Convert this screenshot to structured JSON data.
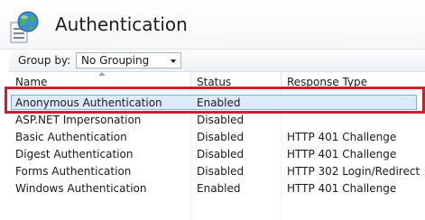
{
  "header": {
    "title": "Authentication",
    "icon": "globe-document-icon"
  },
  "toolbar": {
    "group_by_label": "Group by:",
    "group_by_value": "No Grouping"
  },
  "grid": {
    "columns": [
      "Name",
      "Status",
      "Response Type"
    ],
    "sort_column": "Name",
    "selected_row": 0,
    "rows": [
      {
        "name": "Anonymous Authentication",
        "status": "Enabled",
        "response_type": ""
      },
      {
        "name": "ASP.NET Impersonation",
        "status": "Disabled",
        "response_type": ""
      },
      {
        "name": "Basic Authentication",
        "status": "Disabled",
        "response_type": "HTTP 401 Challenge"
      },
      {
        "name": "Digest Authentication",
        "status": "Disabled",
        "response_type": "HTTP 401 Challenge"
      },
      {
        "name": "Forms Authentication",
        "status": "Disabled",
        "response_type": "HTTP 302 Login/Redirect"
      },
      {
        "name": "Windows Authentication",
        "status": "Enabled",
        "response_type": "HTTP 401 Challenge"
      }
    ]
  },
  "colors": {
    "highlight_border": "#c8202e",
    "selection_fill": "#dcebfc",
    "selection_border": "#84acdd"
  }
}
